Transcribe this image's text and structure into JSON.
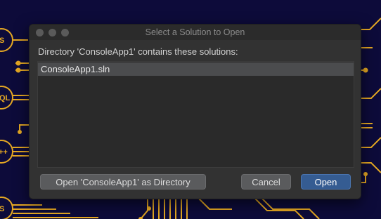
{
  "dialog": {
    "title": "Select a Solution to Open",
    "prompt": "Directory 'ConsoleApp1' contains these solutions:",
    "solutions": [
      "ConsoleApp1.sln"
    ],
    "buttons": {
      "open_as_directory": "Open 'ConsoleApp1' as Directory",
      "cancel": "Cancel",
      "open": "Open"
    }
  },
  "background": {
    "badges": [
      "S",
      "QL",
      "++",
      "S"
    ]
  },
  "colors": {
    "background": "#0d0b3a",
    "circuit": "#e5a823",
    "dialog": "#323232",
    "primary_button": "#355c92",
    "selection": "#4b4c4e"
  }
}
